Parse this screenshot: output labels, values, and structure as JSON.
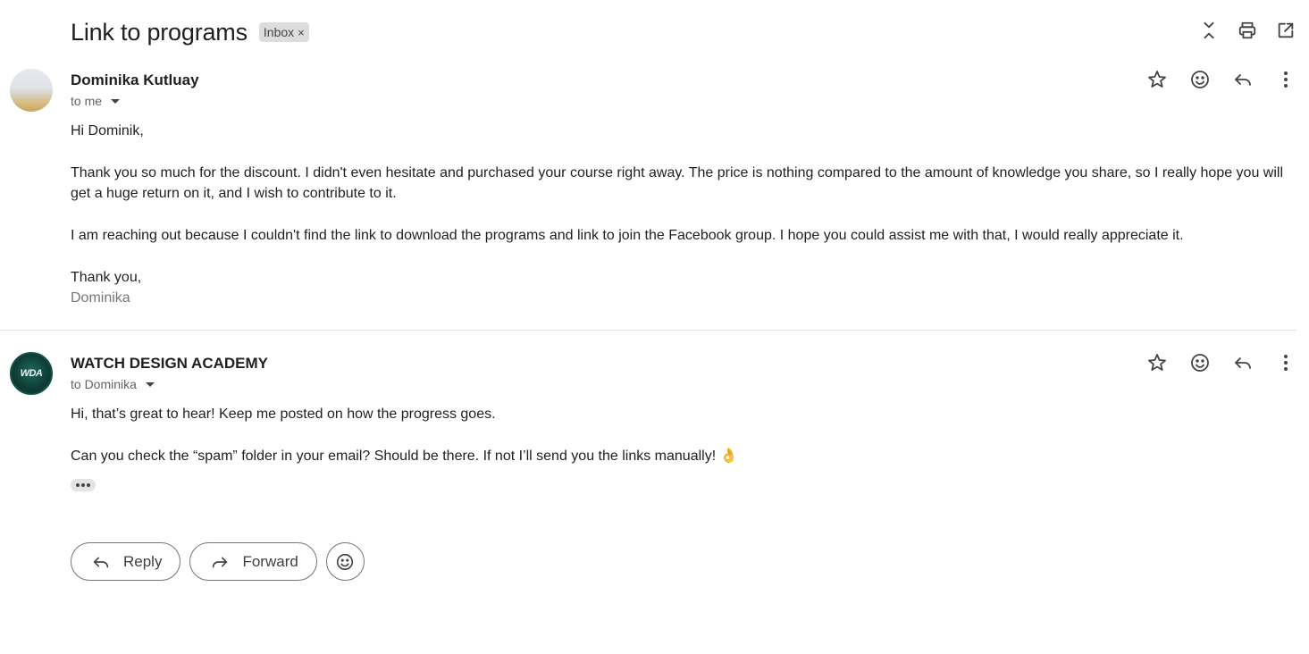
{
  "thread": {
    "subject": "Link to programs",
    "label": "Inbox",
    "label_remove": "×"
  },
  "toolbar": {
    "icons": [
      "collapse-all-icon",
      "print-icon",
      "open-new-window-icon"
    ]
  },
  "messages": [
    {
      "sender": "Dominika Kutluay",
      "recipient": "to me",
      "paragraphs": [
        "Hi Dominik,",
        "Thank you so much for the discount. I didn't even hesitate and purchased your course right away. The price is nothing compared to the amount of knowledge you share, so I really hope you will get a huge return on it, and I wish to contribute to it.",
        "I am reaching out because I couldn't find the link to download the programs and link to join the Facebook group. I hope you could assist me with that, I would really appreciate it.",
        "Thank you,"
      ],
      "signature": "Dominika"
    },
    {
      "sender": "WATCH DESIGN ACADEMY",
      "avatar_text": "WDA",
      "recipient": "to Dominika",
      "paragraphs": [
        "Hi, that’s great to hear! Keep me posted on how the progress goes.",
        "Can you check the “spam” folder in your email? Should be there. If not I’ll send you the links manually! 👌"
      ]
    }
  ],
  "actions": {
    "reply_label": "Reply",
    "forward_label": "Forward"
  },
  "colors": {
    "text": "#1f1f1f",
    "muted": "#5f6368",
    "chip_bg": "#dddddd",
    "divider": "#e3e3e3"
  }
}
